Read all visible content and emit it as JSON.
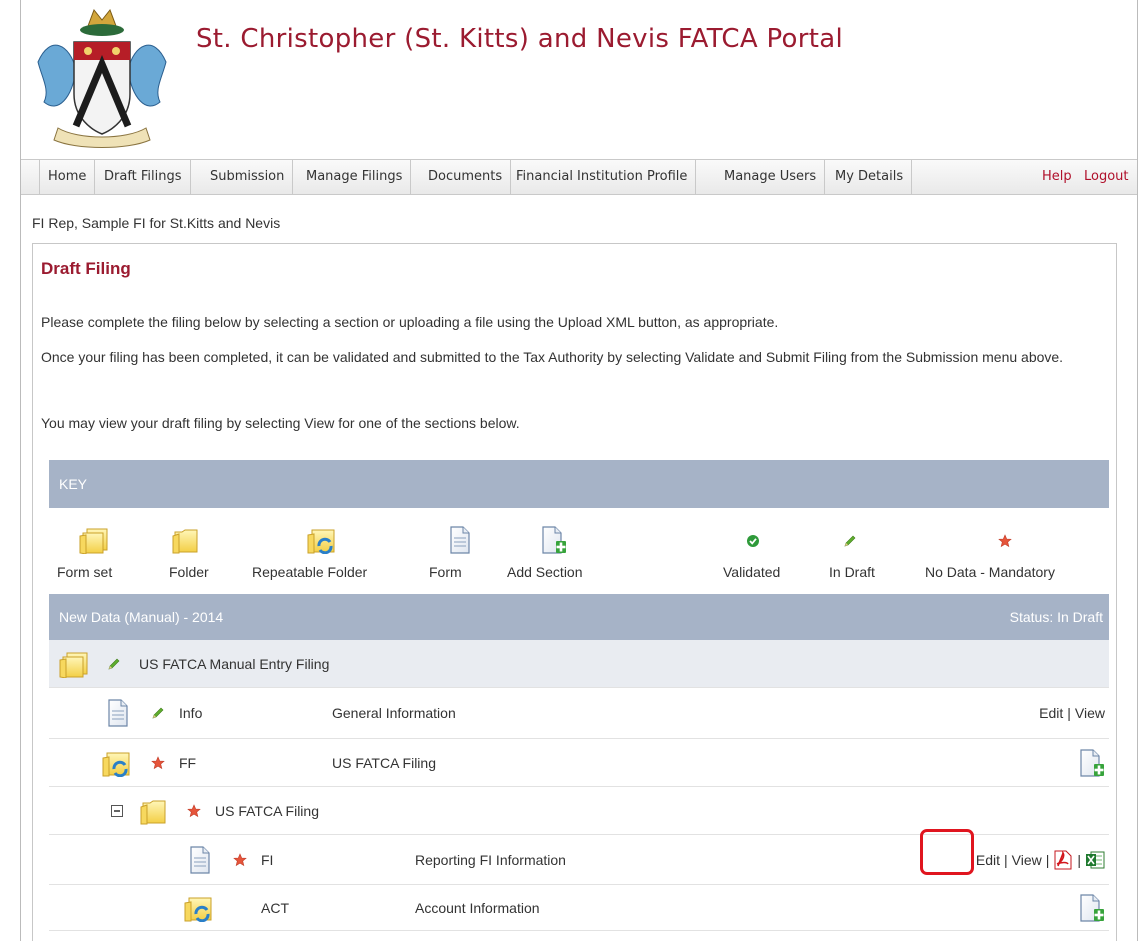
{
  "site": {
    "title": "St. Christopher (St. Kitts) and Nevis FATCA Portal"
  },
  "nav": {
    "items": [
      "Home",
      "Draft Filings",
      "Submission",
      "Manage Filings",
      "Documents",
      "Financial Institution Profile",
      "Manage Users",
      "My Details"
    ],
    "help": "Help",
    "logout": "Logout"
  },
  "user_line": "FI Rep, Sample FI for St.Kitts and Nevis",
  "page": {
    "title": "Draft Filing",
    "para1": "Please complete the filing below by selecting a section or uploading a file using the Upload XML button, as appropriate.",
    "para2": "Once your filing has been completed, it can be validated and submitted to the Tax Authority by selecting Validate and Submit Filing from the Submission menu above.",
    "para3": "You may view your draft filing by selecting View for one of the sections below."
  },
  "key": {
    "header": "KEY",
    "items": [
      "Form set",
      "Folder",
      "Repeatable Folder",
      "Form",
      "Add Section",
      "Validated",
      "In Draft",
      "No Data - Mandatory"
    ]
  },
  "data": {
    "header_left": "New Data (Manual) - 2014",
    "header_right": "Status: In Draft",
    "rows": [
      {
        "code": "",
        "name": "US FATCA Manual Entry Filing"
      },
      {
        "code": "Info",
        "name": "General Information",
        "edit": "Edit",
        "view": "View"
      },
      {
        "code": "FF",
        "name": "US FATCA Filing"
      },
      {
        "code": "",
        "name": "US FATCA Filing"
      },
      {
        "code": "FI",
        "name": "Reporting FI Information",
        "edit": "Edit",
        "view": "View"
      },
      {
        "code": "ACT",
        "name": "Account Information"
      }
    ]
  },
  "colors": {
    "brand": "#9b1b30",
    "band": "#a6b3c7",
    "highlight": "#e0151f"
  },
  "icons": [
    "crest-logo",
    "formset-icon",
    "folder-icon",
    "repeatable-folder-icon",
    "form-icon",
    "add-section-icon",
    "validated-icon",
    "in-draft-icon",
    "no-data-mandatory-icon",
    "collapse-icon",
    "pdf-icon",
    "excel-icon"
  ]
}
